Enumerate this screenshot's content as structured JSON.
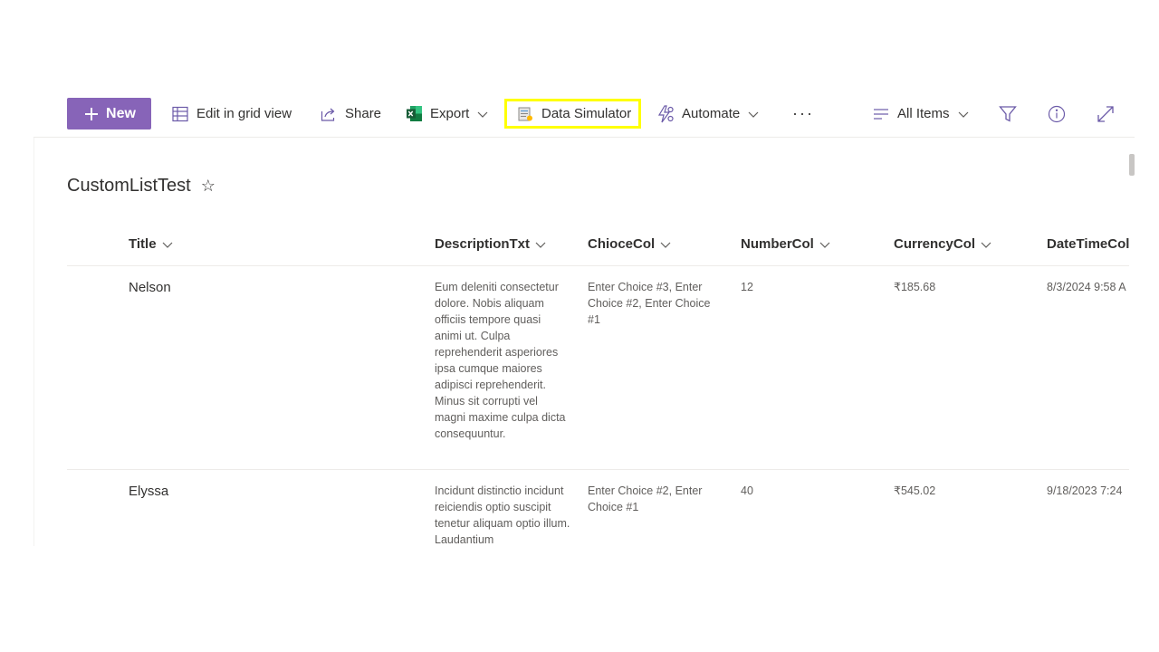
{
  "toolbar": {
    "new_label": "New",
    "grid_label": "Edit in grid view",
    "share_label": "Share",
    "export_label": "Export",
    "simulator_label": "Data Simulator",
    "automate_label": "Automate",
    "more_label": "···",
    "view_label": "All Items",
    "icons": {
      "new": "plus-icon",
      "grid": "grid-icon",
      "share": "share-icon",
      "export": "excel-icon",
      "simulator": "data-simulator-icon",
      "automate": "automate-icon",
      "view": "lines-icon",
      "filter": "filter-icon",
      "info": "info-icon",
      "expand": "expand-icon"
    },
    "accent_color": "#8764b8",
    "highlight_color": "#ffff00"
  },
  "list": {
    "title": "CustomListTest",
    "favorite_icon": "☆",
    "columns": [
      {
        "label": "Title"
      },
      {
        "label": "DescriptionTxt"
      },
      {
        "label": "ChioceCol"
      },
      {
        "label": "NumberCol"
      },
      {
        "label": "CurrencyCol"
      },
      {
        "label": "DateTimeCol"
      }
    ],
    "rows": [
      {
        "title": "Nelson",
        "description": "Eum deleniti consectetur dolore. Nobis aliquam officiis tempore quasi animi ut. Culpa reprehenderit asperiores ipsa cumque maiores adipisci reprehenderit. Minus sit corrupti vel magni maxime culpa dicta consequuntur.",
        "choice": "Enter Choice #3, Enter Choice #2, Enter Choice #1",
        "number": "12",
        "currency": "₹185.68",
        "datetime": "8/3/2024 9:58 A"
      },
      {
        "title": "Elyssa",
        "description": "Incidunt distinctio incidunt reiciendis optio suscipit tenetur aliquam optio illum. Laudantium",
        "choice": "Enter Choice #2, Enter Choice #1",
        "number": "40",
        "currency": "₹545.02",
        "datetime": "9/18/2023 7:24"
      }
    ]
  }
}
